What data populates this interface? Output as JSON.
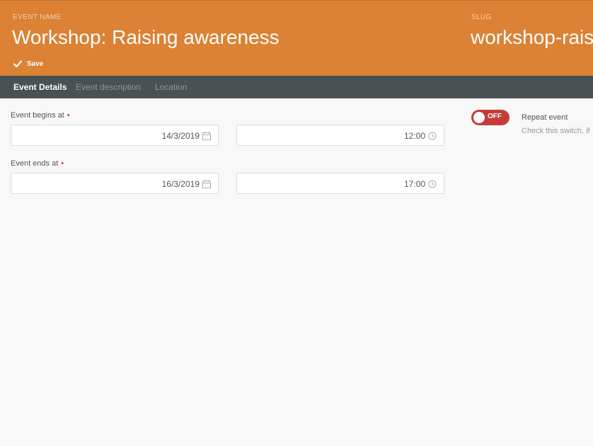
{
  "header": {
    "event_name_label": "EVENT NAME",
    "event_name_value": "Workshop: Raising awareness",
    "slug_label": "SLUG",
    "slug_value": "workshop-raisir",
    "save_label": "Save"
  },
  "tabs": [
    {
      "label": "Event Details",
      "active": true
    },
    {
      "label": "Event description",
      "active": false
    },
    {
      "label": "Location",
      "active": false
    }
  ],
  "form": {
    "begins_label": "Event begins at",
    "begins_date": "14/3/2019",
    "begins_time": "12:00",
    "ends_label": "Event ends at",
    "ends_date": "16/3/2019",
    "ends_time": "17:00",
    "required_mark": "•"
  },
  "repeat": {
    "toggle_state": "OFF",
    "title": "Repeat event",
    "help": "Check this switch, if"
  },
  "colors": {
    "header_bg": "#db8235",
    "tabbar_bg": "#4a5152",
    "toggle_off": "#c73a3a"
  }
}
